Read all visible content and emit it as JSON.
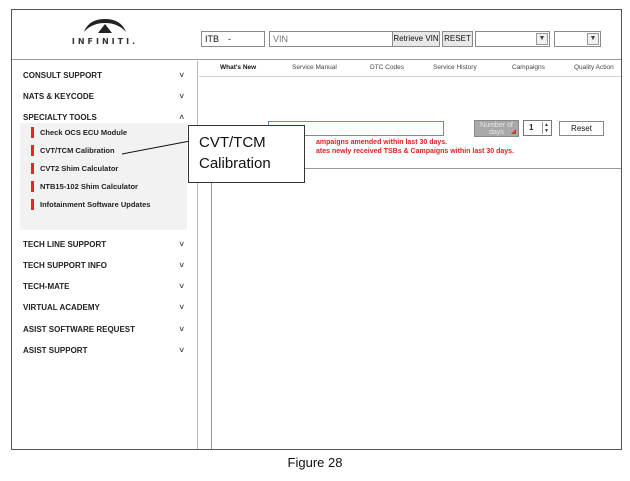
{
  "header": {
    "logo_text": "INFINITI.",
    "region_select": "ITB",
    "vin_placeholder": "VIN",
    "retrieve_vin_label": "Retrieve VIN",
    "reset_label": "RESET"
  },
  "sidebar": {
    "items": [
      {
        "label": "CONSULT SUPPORT",
        "chevron": "˅"
      },
      {
        "label": "NATS & KEYCODE",
        "chevron": "˅"
      },
      {
        "label": "SPECIALTY TOOLS",
        "chevron": "˄"
      },
      {
        "label": "TECH LINE SUPPORT",
        "chevron": "˅"
      },
      {
        "label": "TECH SUPPORT INFO",
        "chevron": "˅"
      },
      {
        "label": "TECH-MATE",
        "chevron": "˅"
      },
      {
        "label": "VIRTUAL ACADEMY",
        "chevron": "˅"
      },
      {
        "label": "ASIST SOFTWARE REQUEST",
        "chevron": "˅"
      },
      {
        "label": "ASIST SUPPORT",
        "chevron": "˅"
      }
    ],
    "sub_items": [
      {
        "label": "Check OCS ECU Module"
      },
      {
        "label": "CVT/TCM Calibration"
      },
      {
        "label": "CVT2 Shim Calculator"
      },
      {
        "label": "NTB15-102 Shim Calculator"
      },
      {
        "label": "Infotainment Software Updates"
      }
    ]
  },
  "main": {
    "tabs": [
      {
        "label": "What's New",
        "active": true
      },
      {
        "label": "Service Manual"
      },
      {
        "label": "DTC Codes"
      },
      {
        "label": "Service History"
      },
      {
        "label": "Campaigns"
      },
      {
        "label": "Quality Action"
      }
    ],
    "number_of_days_label": "Number of days",
    "days_value": "1",
    "reset_label": "Reset",
    "note_1": "ampaigns amended within last 30 days.",
    "note_2": "ates newly received TSBs & Campaigns within last 30 days."
  },
  "callout": {
    "line1": "CVT/TCM",
    "line2": "Calibration"
  },
  "caption": "Figure 28",
  "colors": {
    "accent_red": "#e8232a",
    "input_focus": "#5b8fd1"
  }
}
